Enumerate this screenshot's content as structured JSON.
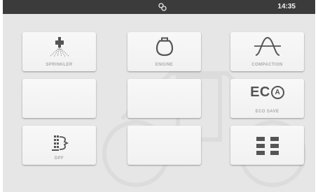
{
  "status_bar": {
    "time": "14:35",
    "center_icon": "steering-link-icon"
  },
  "tiles": {
    "sprinkler": {
      "label": "SPRINKLER",
      "icon": "sprinkler-icon"
    },
    "engine": {
      "label": "ENGINE",
      "icon": "engine-icon"
    },
    "compaction": {
      "label": "COMPACTION",
      "icon": "compaction-wave-icon"
    },
    "eco_save": {
      "logo_text": "EC",
      "logo_badge": "A",
      "label": "ECO SAVE"
    },
    "dpf": {
      "label": "DPF",
      "icon": "dpf-filter-icon"
    },
    "menu": {
      "icon": "grid-menu-icon"
    }
  },
  "colors": {
    "status_bar": "#3b3b3b",
    "background": "#e6e6e6",
    "tile": "#f5f5f5",
    "icon": "#545454",
    "label": "#a9a9a9"
  }
}
